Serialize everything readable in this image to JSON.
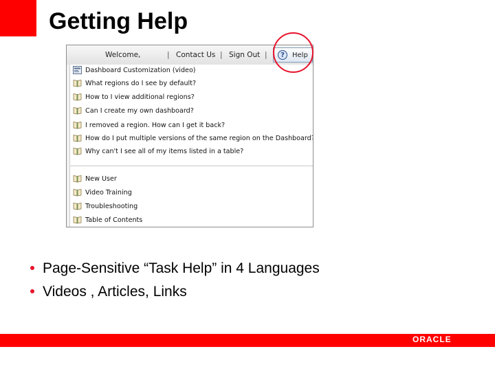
{
  "slide": {
    "title": "Getting Help",
    "bullets": [
      "Page-Sensitive “Task Help” in 4 Languages",
      "Videos , Articles, Links"
    ],
    "logo_text": "ORACLE",
    "colors": {
      "brand_red": "#ff0000",
      "highlight_circle": "#e8122b"
    }
  },
  "app": {
    "header": {
      "welcome": "Welcome,",
      "separator": "|",
      "contact_us": "Contact Us",
      "sign_out": "Sign Out",
      "help": "Help",
      "help_icon": "question-circle-icon"
    },
    "help_menu": {
      "items": [
        {
          "label": "Dashboard Customization (video)",
          "icon": "video-icon"
        },
        {
          "label": "What regions do I see by default?",
          "icon": "book-icon"
        },
        {
          "label": "How to I view additional regions?",
          "icon": "book-icon"
        },
        {
          "label": "Can I create my own dashboard?",
          "icon": "book-icon"
        },
        {
          "label": "I removed a region. How can I get it back?",
          "icon": "book-icon"
        },
        {
          "label": "How do I put multiple versions of the same region on the Dashboard?",
          "icon": "book-icon"
        },
        {
          "label": "Why can't I see all of my items listed in a table?",
          "icon": "book-icon"
        }
      ],
      "resources": [
        {
          "label": "New User",
          "icon": "book-icon"
        },
        {
          "label": "Video Training",
          "icon": "book-icon"
        },
        {
          "label": "Troubleshooting",
          "icon": "book-icon"
        },
        {
          "label": "Table of Contents",
          "icon": "book-icon"
        }
      ]
    }
  }
}
